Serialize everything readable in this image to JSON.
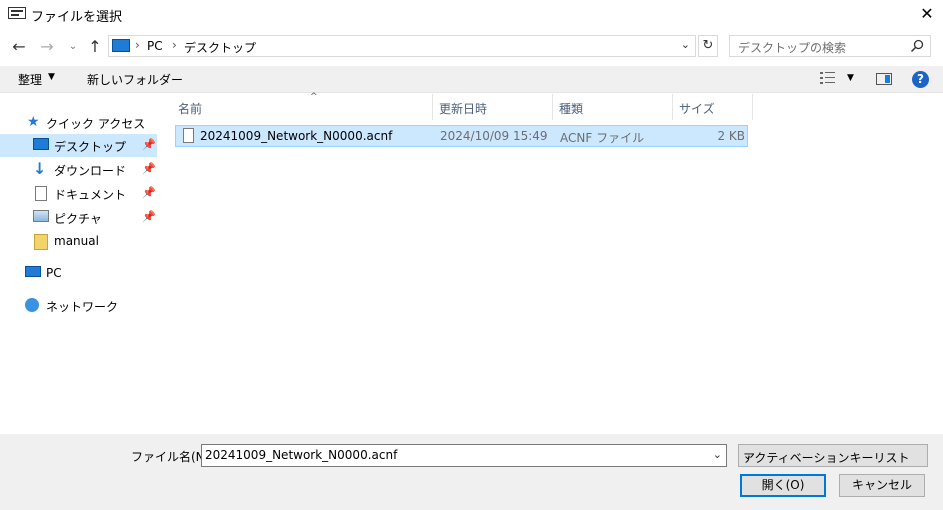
{
  "window": {
    "title": "ファイルを選択",
    "close_glyph": "✕"
  },
  "nav": {
    "back": "←",
    "forward": "→",
    "recent": "⌄",
    "up": "↑"
  },
  "address": {
    "pc": "PC",
    "folder": "デスクトップ",
    "sep": "›",
    "dropdown": "⌄",
    "refresh": "↻"
  },
  "search": {
    "placeholder": "デスクトップの検索"
  },
  "toolbar": {
    "organize": "整理",
    "organize_arrow": "▼",
    "new_folder": "新しいフォルダー",
    "view_arrow": "▼",
    "help": "?"
  },
  "sidebar": {
    "quick_access": "クイック アクセス",
    "items": [
      {
        "label": "デスクトップ",
        "icon": "desktop-icon"
      },
      {
        "label": "ダウンロード",
        "icon": "download-icon"
      },
      {
        "label": "ドキュメント",
        "icon": "document-icon"
      },
      {
        "label": "ピクチャ",
        "icon": "pictures-icon"
      },
      {
        "label": "manual",
        "icon": "folder-icon"
      }
    ],
    "pc": "PC",
    "network": "ネットワーク"
  },
  "columns": {
    "name": "名前",
    "date": "更新日時",
    "type": "種類",
    "size": "サイズ",
    "sort_glyph": "^"
  },
  "files": [
    {
      "name": "20241009_Network_N0000.acnf",
      "date": "2024/10/09 15:49",
      "type": "ACNF ファイル",
      "size": "2 KB"
    }
  ],
  "bottom": {
    "filename_label": "ファイル名(N):",
    "filename_value": "20241009_Network_N0000.acnf",
    "filetype": "アクティベーションキーリストファイル (*",
    "open": "開く(O)",
    "cancel": "キャンセル"
  }
}
